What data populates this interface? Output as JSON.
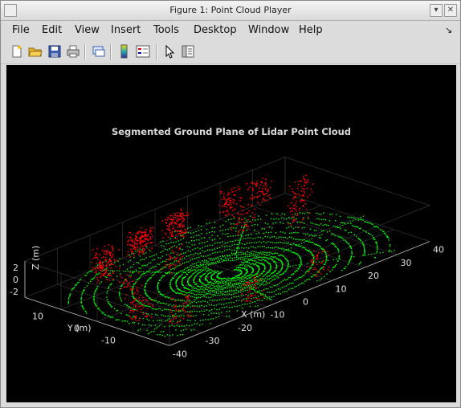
{
  "window": {
    "title": "Figure 1: Point Cloud Player"
  },
  "menu": [
    "File",
    "Edit",
    "View",
    "Insert",
    "Tools",
    "Desktop",
    "Window",
    "Help"
  ],
  "toolbar": [
    "new-figure-icon",
    "open-file-icon",
    "save-icon",
    "print-icon",
    "link-plot-icon",
    "colorbar-icon",
    "legend-icon",
    "pointer-icon",
    "property-inspector-icon"
  ],
  "plot": {
    "title": "Segmented Ground Plane of Lidar Point Cloud",
    "xlabel": "X (m)",
    "ylabel": "Y (m)",
    "zlabel": "Z (m)",
    "xticks": [
      "-40",
      "-30",
      "-20",
      "-10",
      "0",
      "10",
      "20",
      "30",
      "40"
    ],
    "yticks": [
      "10",
      "0",
      "-10"
    ],
    "zticks": [
      "2",
      "0",
      "-2"
    ],
    "colors": {
      "ground": "#00ff00",
      "obstacle": "#ff0000",
      "background": "#000000"
    }
  }
}
